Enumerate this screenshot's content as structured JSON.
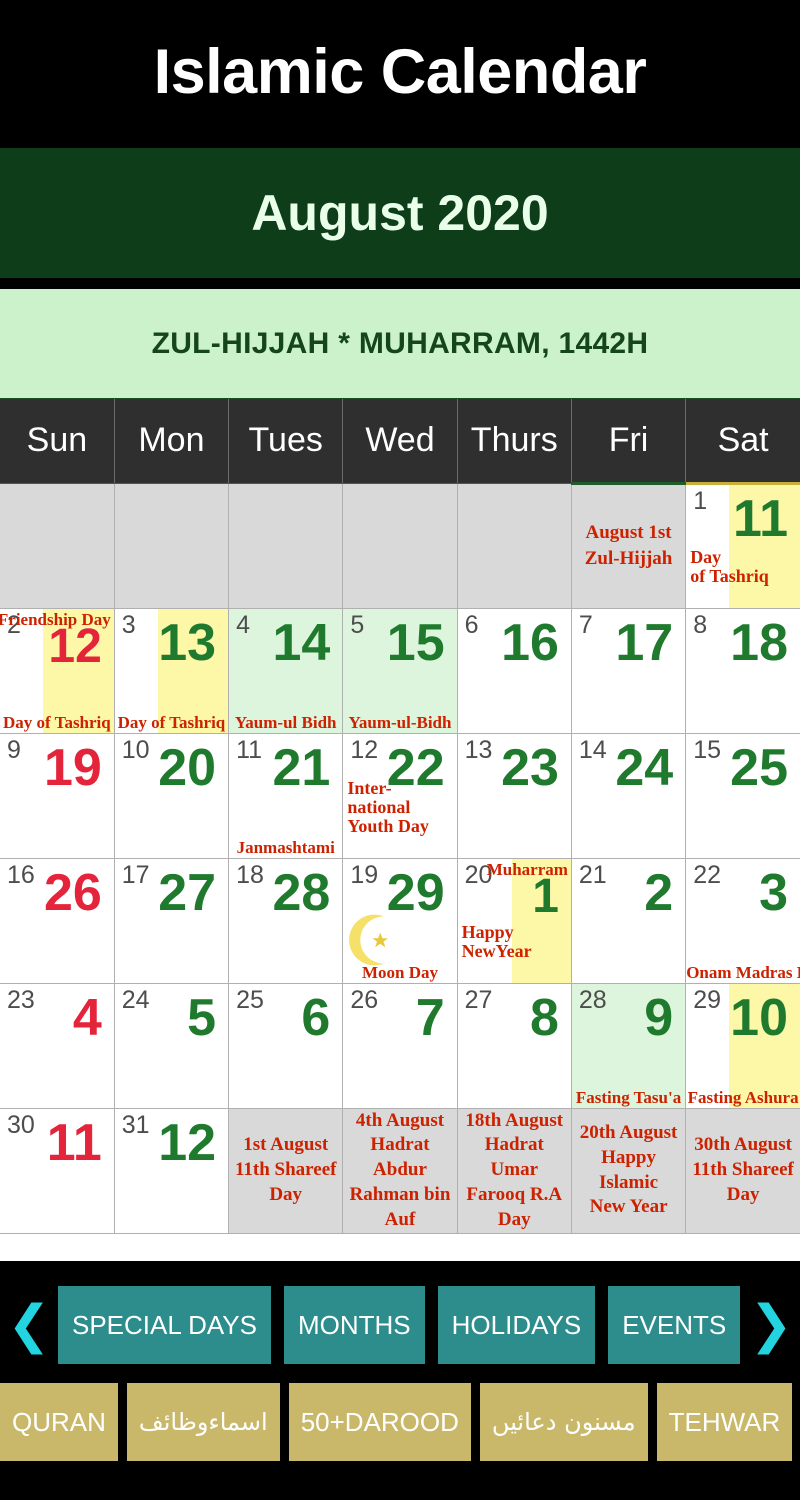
{
  "app": {
    "title": "Islamic Calendar",
    "month_label": "August 2020",
    "hijri_label": "ZUL-HIJJAH * MUHARRAM, 1442H",
    "colors": {
      "title_bg": "#000000",
      "month_bg": "#0d3d19",
      "hijri_bg": "#ccf2cc",
      "weekday_bg": "#2f2f2f",
      "highlight_yellow": "#fdf7a8",
      "highlight_green": "#ddf5dd",
      "event_red": "#cc2200",
      "hijri_green": "#1f7a2e",
      "hijri_red": "#e4243b",
      "nav_teal": "#2d8c8c",
      "nav_gold": "#c9b86a",
      "arrow_cyan": "#22d3e0"
    }
  },
  "weekdays": [
    "Sun",
    "Mon",
    "Tues",
    "Wed",
    "Thurs",
    "Fri",
    "Sat"
  ],
  "weeks": [
    [
      {
        "type": "empty"
      },
      {
        "type": "empty"
      },
      {
        "type": "empty"
      },
      {
        "type": "empty"
      },
      {
        "type": "empty"
      },
      {
        "type": "note",
        "note_lines": [
          "August 1st",
          "Zul-Hijjah"
        ]
      },
      {
        "type": "day",
        "greg": "1",
        "hijri": "11",
        "hijri_color": "green",
        "bg": "white",
        "band": "yellow",
        "left_lines": [
          "Day",
          "of Tashriq"
        ]
      }
    ],
    [
      {
        "type": "day",
        "greg": "2",
        "hijri": "12",
        "hijri_color": "red",
        "bg": "white",
        "band": "yellow",
        "top_label": "Friendship Day",
        "bottom_label": "Day of Tashriq"
      },
      {
        "type": "day",
        "greg": "3",
        "hijri": "13",
        "hijri_color": "green",
        "bg": "white",
        "band": "yellow",
        "bottom_label": "Day of Tashriq"
      },
      {
        "type": "day",
        "greg": "4",
        "hijri": "14",
        "hijri_color": "green",
        "bg": "green",
        "bottom_label": "Yaum-ul Bidh"
      },
      {
        "type": "day",
        "greg": "5",
        "hijri": "15",
        "hijri_color": "green",
        "bg": "green",
        "bottom_label": "Yaum-ul-Bidh"
      },
      {
        "type": "day",
        "greg": "6",
        "hijri": "16",
        "hijri_color": "green",
        "bg": "white"
      },
      {
        "type": "day",
        "greg": "7",
        "hijri": "17",
        "hijri_color": "green",
        "bg": "white"
      },
      {
        "type": "day",
        "greg": "8",
        "hijri": "18",
        "hijri_color": "green",
        "bg": "white"
      }
    ],
    [
      {
        "type": "day",
        "greg": "9",
        "hijri": "19",
        "hijri_color": "red",
        "bg": "white"
      },
      {
        "type": "day",
        "greg": "10",
        "hijri": "20",
        "hijri_color": "green",
        "bg": "white"
      },
      {
        "type": "day",
        "greg": "11",
        "hijri": "21",
        "hijri_color": "green",
        "bg": "white",
        "bottom_label": "Janmashtami"
      },
      {
        "type": "day",
        "greg": "12",
        "hijri": "22",
        "hijri_color": "green",
        "bg": "white",
        "left_lines": [
          "Inter-",
          "national Youth Day"
        ]
      },
      {
        "type": "day",
        "greg": "13",
        "hijri": "23",
        "hijri_color": "green",
        "bg": "white"
      },
      {
        "type": "day",
        "greg": "14",
        "hijri": "24",
        "hijri_color": "green",
        "bg": "white"
      },
      {
        "type": "day",
        "greg": "15",
        "hijri": "25",
        "hijri_color": "green",
        "bg": "white"
      }
    ],
    [
      {
        "type": "day",
        "greg": "16",
        "hijri": "26",
        "hijri_color": "red",
        "bg": "white"
      },
      {
        "type": "day",
        "greg": "17",
        "hijri": "27",
        "hijri_color": "green",
        "bg": "white"
      },
      {
        "type": "day",
        "greg": "18",
        "hijri": "28",
        "hijri_color": "green",
        "bg": "white"
      },
      {
        "type": "day",
        "greg": "19",
        "hijri": "29",
        "hijri_color": "green",
        "bg": "white",
        "moon": true,
        "bottom_label": "Moon Day"
      },
      {
        "type": "day",
        "greg": "20",
        "hijri": "1",
        "hijri_color": "green",
        "bg": "white",
        "band": "yellow",
        "top_label": "Muharram",
        "left_lines": [
          "Happy",
          "NewYear"
        ]
      },
      {
        "type": "day",
        "greg": "21",
        "hijri": "2",
        "hijri_color": "green",
        "bg": "white"
      },
      {
        "type": "day",
        "greg": "22",
        "hijri": "3",
        "hijri_color": "green",
        "bg": "white",
        "bottom_label": "Onam Madras Day"
      }
    ],
    [
      {
        "type": "day",
        "greg": "23",
        "hijri": "4",
        "hijri_color": "red",
        "bg": "white"
      },
      {
        "type": "day",
        "greg": "24",
        "hijri": "5",
        "hijri_color": "green",
        "bg": "white"
      },
      {
        "type": "day",
        "greg": "25",
        "hijri": "6",
        "hijri_color": "green",
        "bg": "white"
      },
      {
        "type": "day",
        "greg": "26",
        "hijri": "7",
        "hijri_color": "green",
        "bg": "white"
      },
      {
        "type": "day",
        "greg": "27",
        "hijri": "8",
        "hijri_color": "green",
        "bg": "white"
      },
      {
        "type": "day",
        "greg": "28",
        "hijri": "9",
        "hijri_color": "green",
        "bg": "green",
        "bottom_label": "Fasting Tasu'a"
      },
      {
        "type": "day",
        "greg": "29",
        "hijri": "10",
        "hijri_color": "green",
        "bg": "white",
        "band": "yellow",
        "bottom_label": "Fasting Ashura"
      }
    ],
    [
      {
        "type": "day",
        "greg": "30",
        "hijri": "11",
        "hijri_color": "red",
        "bg": "white"
      },
      {
        "type": "day",
        "greg": "31",
        "hijri": "12",
        "hijri_color": "green",
        "bg": "white"
      },
      {
        "type": "event",
        "bg": "grey",
        "event_lines": [
          "1st August",
          "11th Shareef",
          "Day"
        ]
      },
      {
        "type": "event",
        "bg": "grey",
        "event_lines": [
          "4th August",
          "Hadrat Abdur",
          "Rahman bin Auf"
        ]
      },
      {
        "type": "event",
        "bg": "grey",
        "event_lines": [
          "18th August",
          "Hadrat Umar",
          "Farooq R.A Day"
        ]
      },
      {
        "type": "event",
        "bg": "grey",
        "event_lines": [
          "20th August",
          "Happy Islamic",
          "New Year"
        ]
      },
      {
        "type": "event",
        "bg": "grey",
        "event_lines": [
          "30th August",
          "11th Shareef",
          "Day"
        ]
      }
    ]
  ],
  "nav": {
    "prev_icon": "chevron-left-icon",
    "next_icon": "chevron-right-icon",
    "prev_glyph": "❮",
    "next_glyph": "❯",
    "primary": [
      {
        "label": "SPECIAL DAYS"
      },
      {
        "label": "MONTHS"
      },
      {
        "label": "HOLIDAYS"
      },
      {
        "label": "EVENTS"
      }
    ],
    "secondary": [
      {
        "label": "QURAN",
        "rtl": false
      },
      {
        "label": "اسماءوظائف",
        "rtl": true
      },
      {
        "label": "50+DAROOD",
        "rtl": false
      },
      {
        "label": "مسنون دعائیں",
        "rtl": true
      },
      {
        "label": "TEHWAR",
        "rtl": false
      }
    ]
  }
}
